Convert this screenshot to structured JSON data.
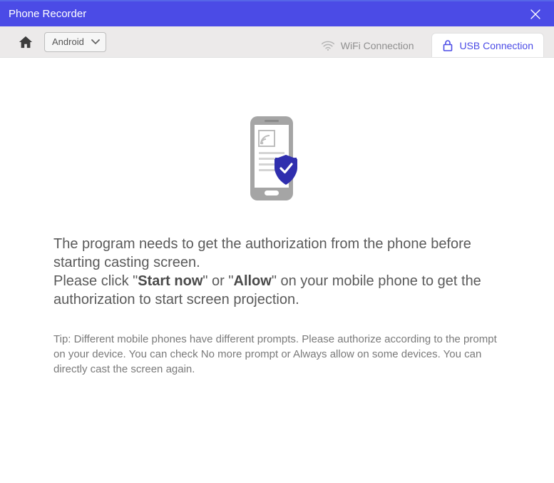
{
  "window": {
    "title": "Phone Recorder"
  },
  "toolbar": {
    "platform_selected": "Android",
    "tabs": {
      "wifi": "WiFi Connection",
      "usb": "USB Connection"
    },
    "active_tab": "usb"
  },
  "content": {
    "line1": "The program needs to get the authorization from the phone before starting casting screen.",
    "line2_pre": "Please click \"",
    "line2_bold1": "Start now",
    "line2_mid": "\" or \"",
    "line2_bold2": "Allow",
    "line2_post": "\" on your mobile phone to get the authorization to start screen projection.",
    "tip": "Tip: Different mobile phones have different prompts. Please authorize according to the prompt on your device. You can check No more prompt or Always allow on some devices. You can directly cast the screen again."
  },
  "icons": {
    "home": "home-icon",
    "chevron": "chevron-down-icon",
    "wifi": "wifi-icon",
    "usb": "lock-icon",
    "close": "close-icon"
  }
}
